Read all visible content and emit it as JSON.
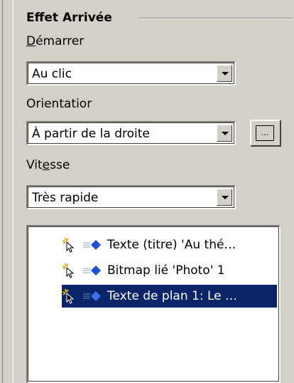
{
  "section": {
    "title": "Effet Arrivée"
  },
  "start": {
    "label": "Démarrer",
    "value": "Au clic"
  },
  "direction": {
    "label": "Orientatior",
    "value": "À partir de la droite",
    "extra_button": "..."
  },
  "speed": {
    "label": "Vitesse",
    "value": "Très rapide"
  },
  "effects_list": {
    "items": [
      {
        "label": "Texte (titre) 'Au thé…",
        "selected": false
      },
      {
        "label": "Bitmap lié 'Photo' 1",
        "selected": false
      },
      {
        "label": "Texte de plan 1: Le …",
        "selected": true
      }
    ]
  },
  "colors": {
    "panel": "#d4d0c8",
    "selection": "#0a246a",
    "effect_icon": "#1f4fd6"
  }
}
